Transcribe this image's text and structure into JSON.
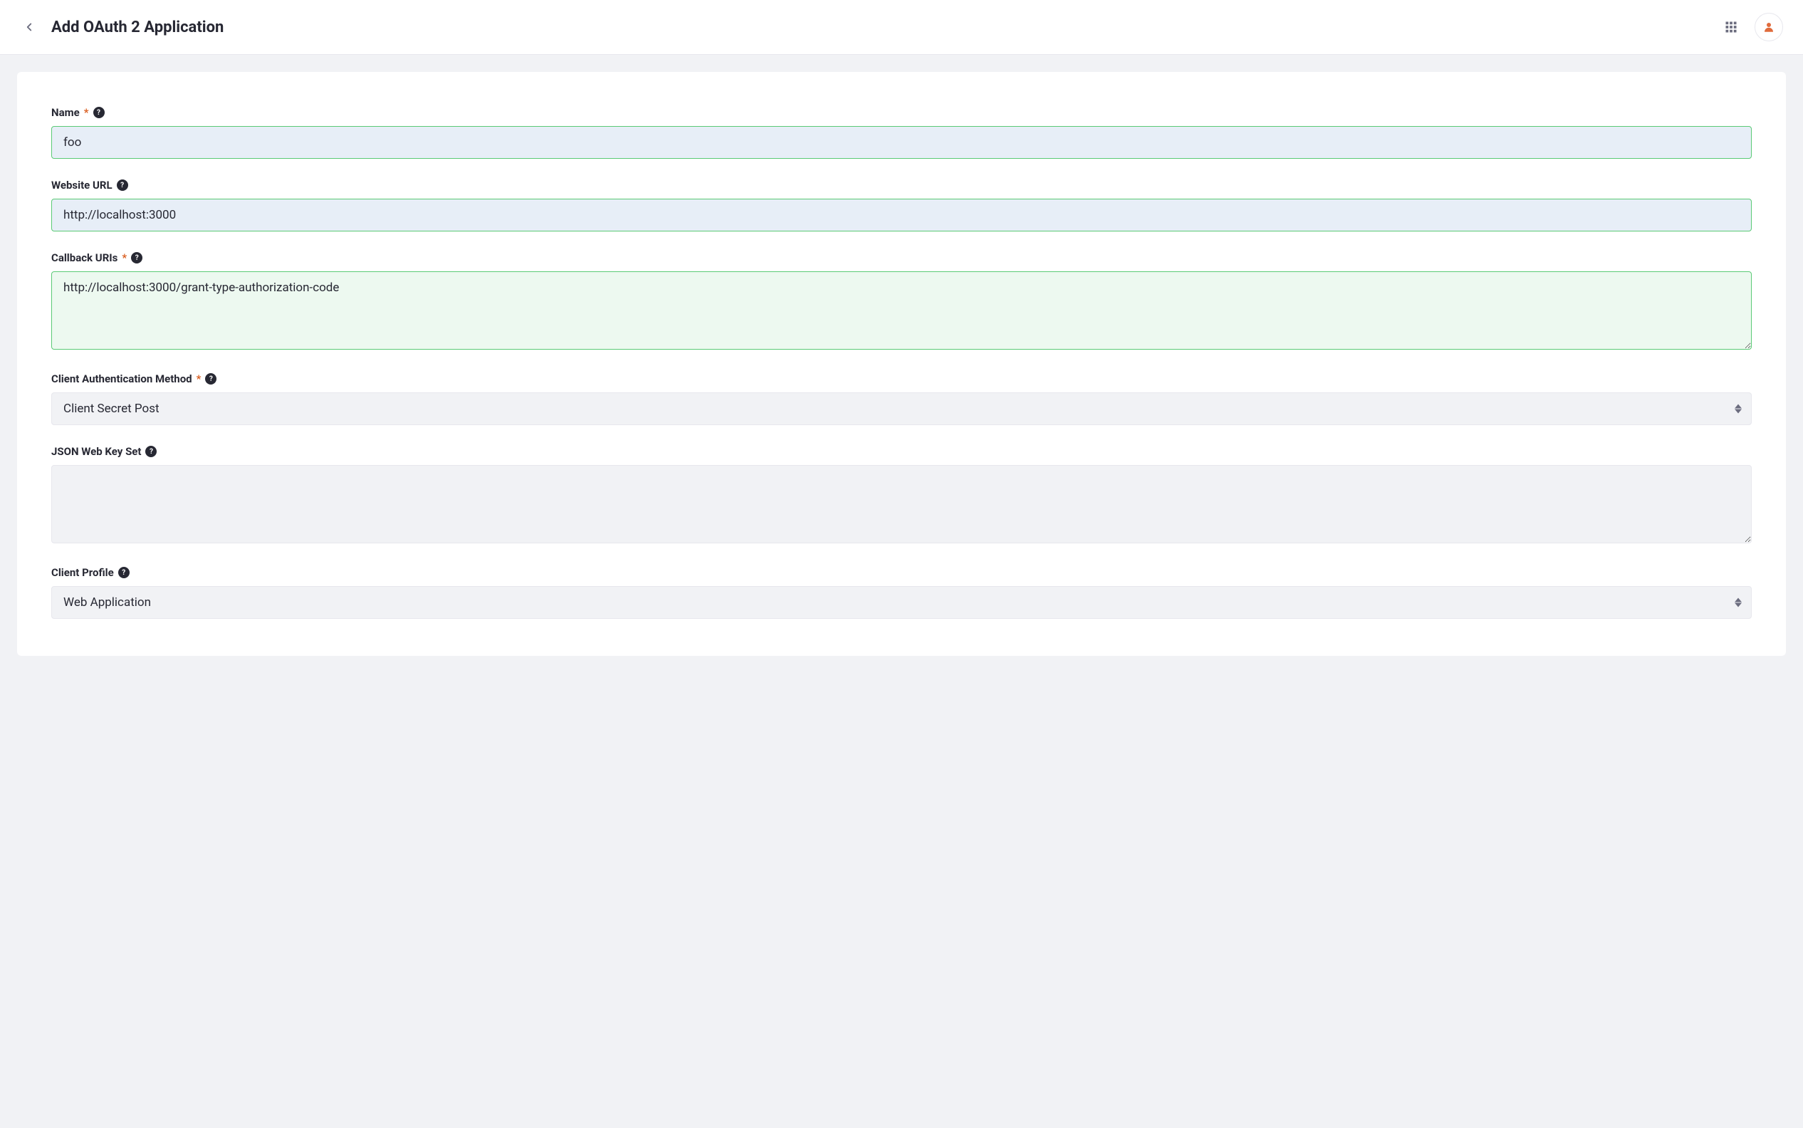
{
  "header": {
    "title": "Add OAuth 2 Application"
  },
  "form": {
    "name": {
      "label": "Name",
      "value": "foo"
    },
    "website_url": {
      "label": "Website URL",
      "value": "http://localhost:3000"
    },
    "callback_uris": {
      "label": "Callback URIs",
      "value": "http://localhost:3000/grant-type-authorization-code"
    },
    "client_auth_method": {
      "label": "Client Authentication Method",
      "value": "Client Secret Post"
    },
    "jwks": {
      "label": "JSON Web Key Set",
      "value": ""
    },
    "client_profile": {
      "label": "Client Profile",
      "value": "Web Application"
    }
  }
}
